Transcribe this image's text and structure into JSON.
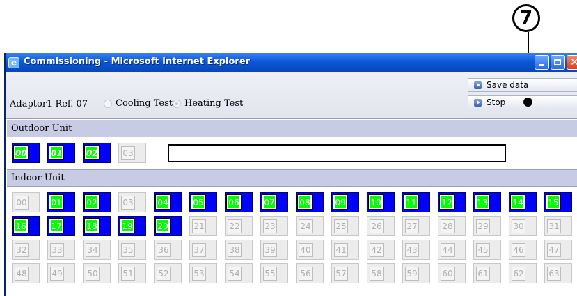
{
  "callout": {
    "number": "7"
  },
  "window": {
    "title": "Commissioning - Microsoft Internet Explorer"
  },
  "toolbar": {
    "adaptor_label": "Adaptor1  Ref. 07",
    "cooling_label": "Cooling Test",
    "heating_label": "Heating Test",
    "selected_mode": "Heating Test",
    "save_label": "Save data",
    "stop_label": "Stop"
  },
  "outdoor": {
    "header": "Outdoor Unit",
    "text_value": "",
    "units": [
      {
        "label": "00",
        "active": true
      },
      {
        "label": "01",
        "active": true
      },
      {
        "label": "02",
        "active": true
      },
      {
        "label": "03",
        "active": false
      }
    ]
  },
  "indoor": {
    "header": "Indoor Unit",
    "units": [
      {
        "label": "00",
        "active": false
      },
      {
        "label": "01",
        "active": true
      },
      {
        "label": "02",
        "active": true
      },
      {
        "label": "03",
        "active": false
      },
      {
        "label": "04",
        "active": true
      },
      {
        "label": "05",
        "active": true
      },
      {
        "label": "06",
        "active": true
      },
      {
        "label": "07",
        "active": true
      },
      {
        "label": "08",
        "active": true
      },
      {
        "label": "09",
        "active": true
      },
      {
        "label": "10",
        "active": true
      },
      {
        "label": "11",
        "active": true
      },
      {
        "label": "12",
        "active": true
      },
      {
        "label": "13",
        "active": true
      },
      {
        "label": "14",
        "active": true
      },
      {
        "label": "15",
        "active": true
      },
      {
        "label": "16",
        "active": true
      },
      {
        "label": "17",
        "active": true
      },
      {
        "label": "18",
        "active": true
      },
      {
        "label": "19",
        "active": true
      },
      {
        "label": "20",
        "active": true
      },
      {
        "label": "21",
        "active": false
      },
      {
        "label": "22",
        "active": false
      },
      {
        "label": "23",
        "active": false
      },
      {
        "label": "24",
        "active": false
      },
      {
        "label": "25",
        "active": false
      },
      {
        "label": "26",
        "active": false
      },
      {
        "label": "27",
        "active": false
      },
      {
        "label": "28",
        "active": false
      },
      {
        "label": "29",
        "active": false
      },
      {
        "label": "30",
        "active": false
      },
      {
        "label": "31",
        "active": false
      },
      {
        "label": "32",
        "active": false
      },
      {
        "label": "33",
        "active": false
      },
      {
        "label": "34",
        "active": false
      },
      {
        "label": "35",
        "active": false
      },
      {
        "label": "36",
        "active": false
      },
      {
        "label": "37",
        "active": false
      },
      {
        "label": "38",
        "active": false
      },
      {
        "label": "39",
        "active": false
      },
      {
        "label": "40",
        "active": false
      },
      {
        "label": "41",
        "active": false
      },
      {
        "label": "42",
        "active": false
      },
      {
        "label": "43",
        "active": false
      },
      {
        "label": "44",
        "active": false
      },
      {
        "label": "45",
        "active": false
      },
      {
        "label": "46",
        "active": false
      },
      {
        "label": "47",
        "active": false
      },
      {
        "label": "48",
        "active": false
      },
      {
        "label": "49",
        "active": false
      },
      {
        "label": "50",
        "active": false
      },
      {
        "label": "51",
        "active": false
      },
      {
        "label": "52",
        "active": false
      },
      {
        "label": "53",
        "active": false
      },
      {
        "label": "54",
        "active": false
      },
      {
        "label": "55",
        "active": false
      },
      {
        "label": "56",
        "active": false
      },
      {
        "label": "57",
        "active": false
      },
      {
        "label": "58",
        "active": false
      },
      {
        "label": "59",
        "active": false
      },
      {
        "label": "60",
        "active": false
      },
      {
        "label": "61",
        "active": false
      },
      {
        "label": "62",
        "active": false
      },
      {
        "label": "63",
        "active": false
      }
    ]
  },
  "colors": {
    "active_bg": "#0000ff",
    "active_cell": "#00ff00",
    "inactive_cell": "#f4f4f4",
    "header_bg": "#c7cbe3"
  }
}
